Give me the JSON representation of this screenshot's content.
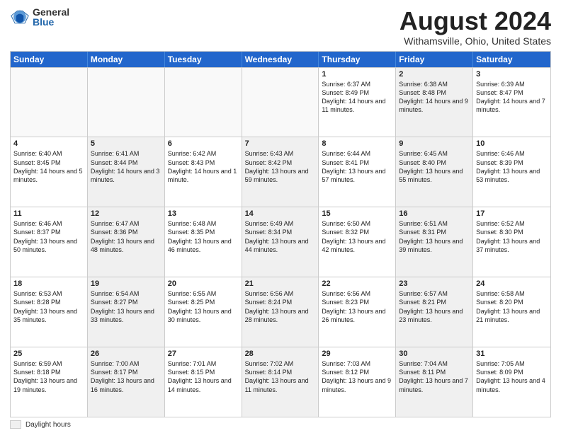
{
  "logo": {
    "general": "General",
    "blue": "Blue"
  },
  "title": "August 2024",
  "location": "Withamsville, Ohio, United States",
  "weekdays": [
    "Sunday",
    "Monday",
    "Tuesday",
    "Wednesday",
    "Thursday",
    "Friday",
    "Saturday"
  ],
  "legend": {
    "box_label": "Daylight hours"
  },
  "rows": [
    [
      {
        "day": "",
        "text": "",
        "empty": true
      },
      {
        "day": "",
        "text": "",
        "empty": true
      },
      {
        "day": "",
        "text": "",
        "empty": true
      },
      {
        "day": "",
        "text": "",
        "empty": true
      },
      {
        "day": "1",
        "text": "Sunrise: 6:37 AM\nSunset: 8:49 PM\nDaylight: 14 hours and 11 minutes."
      },
      {
        "day": "2",
        "text": "Sunrise: 6:38 AM\nSunset: 8:48 PM\nDaylight: 14 hours and 9 minutes.",
        "shaded": true
      },
      {
        "day": "3",
        "text": "Sunrise: 6:39 AM\nSunset: 8:47 PM\nDaylight: 14 hours and 7 minutes."
      }
    ],
    [
      {
        "day": "4",
        "text": "Sunrise: 6:40 AM\nSunset: 8:45 PM\nDaylight: 14 hours and 5 minutes."
      },
      {
        "day": "5",
        "text": "Sunrise: 6:41 AM\nSunset: 8:44 PM\nDaylight: 14 hours and 3 minutes.",
        "shaded": true
      },
      {
        "day": "6",
        "text": "Sunrise: 6:42 AM\nSunset: 8:43 PM\nDaylight: 14 hours and 1 minute."
      },
      {
        "day": "7",
        "text": "Sunrise: 6:43 AM\nSunset: 8:42 PM\nDaylight: 13 hours and 59 minutes.",
        "shaded": true
      },
      {
        "day": "8",
        "text": "Sunrise: 6:44 AM\nSunset: 8:41 PM\nDaylight: 13 hours and 57 minutes."
      },
      {
        "day": "9",
        "text": "Sunrise: 6:45 AM\nSunset: 8:40 PM\nDaylight: 13 hours and 55 minutes.",
        "shaded": true
      },
      {
        "day": "10",
        "text": "Sunrise: 6:46 AM\nSunset: 8:39 PM\nDaylight: 13 hours and 53 minutes."
      }
    ],
    [
      {
        "day": "11",
        "text": "Sunrise: 6:46 AM\nSunset: 8:37 PM\nDaylight: 13 hours and 50 minutes."
      },
      {
        "day": "12",
        "text": "Sunrise: 6:47 AM\nSunset: 8:36 PM\nDaylight: 13 hours and 48 minutes.",
        "shaded": true
      },
      {
        "day": "13",
        "text": "Sunrise: 6:48 AM\nSunset: 8:35 PM\nDaylight: 13 hours and 46 minutes."
      },
      {
        "day": "14",
        "text": "Sunrise: 6:49 AM\nSunset: 8:34 PM\nDaylight: 13 hours and 44 minutes.",
        "shaded": true
      },
      {
        "day": "15",
        "text": "Sunrise: 6:50 AM\nSunset: 8:32 PM\nDaylight: 13 hours and 42 minutes."
      },
      {
        "day": "16",
        "text": "Sunrise: 6:51 AM\nSunset: 8:31 PM\nDaylight: 13 hours and 39 minutes.",
        "shaded": true
      },
      {
        "day": "17",
        "text": "Sunrise: 6:52 AM\nSunset: 8:30 PM\nDaylight: 13 hours and 37 minutes."
      }
    ],
    [
      {
        "day": "18",
        "text": "Sunrise: 6:53 AM\nSunset: 8:28 PM\nDaylight: 13 hours and 35 minutes."
      },
      {
        "day": "19",
        "text": "Sunrise: 6:54 AM\nSunset: 8:27 PM\nDaylight: 13 hours and 33 minutes.",
        "shaded": true
      },
      {
        "day": "20",
        "text": "Sunrise: 6:55 AM\nSunset: 8:25 PM\nDaylight: 13 hours and 30 minutes."
      },
      {
        "day": "21",
        "text": "Sunrise: 6:56 AM\nSunset: 8:24 PM\nDaylight: 13 hours and 28 minutes.",
        "shaded": true
      },
      {
        "day": "22",
        "text": "Sunrise: 6:56 AM\nSunset: 8:23 PM\nDaylight: 13 hours and 26 minutes."
      },
      {
        "day": "23",
        "text": "Sunrise: 6:57 AM\nSunset: 8:21 PM\nDaylight: 13 hours and 23 minutes.",
        "shaded": true
      },
      {
        "day": "24",
        "text": "Sunrise: 6:58 AM\nSunset: 8:20 PM\nDaylight: 13 hours and 21 minutes."
      }
    ],
    [
      {
        "day": "25",
        "text": "Sunrise: 6:59 AM\nSunset: 8:18 PM\nDaylight: 13 hours and 19 minutes."
      },
      {
        "day": "26",
        "text": "Sunrise: 7:00 AM\nSunset: 8:17 PM\nDaylight: 13 hours and 16 minutes.",
        "shaded": true
      },
      {
        "day": "27",
        "text": "Sunrise: 7:01 AM\nSunset: 8:15 PM\nDaylight: 13 hours and 14 minutes."
      },
      {
        "day": "28",
        "text": "Sunrise: 7:02 AM\nSunset: 8:14 PM\nDaylight: 13 hours and 11 minutes.",
        "shaded": true
      },
      {
        "day": "29",
        "text": "Sunrise: 7:03 AM\nSunset: 8:12 PM\nDaylight: 13 hours and 9 minutes."
      },
      {
        "day": "30",
        "text": "Sunrise: 7:04 AM\nSunset: 8:11 PM\nDaylight: 13 hours and 7 minutes.",
        "shaded": true
      },
      {
        "day": "31",
        "text": "Sunrise: 7:05 AM\nSunset: 8:09 PM\nDaylight: 13 hours and 4 minutes."
      }
    ]
  ]
}
